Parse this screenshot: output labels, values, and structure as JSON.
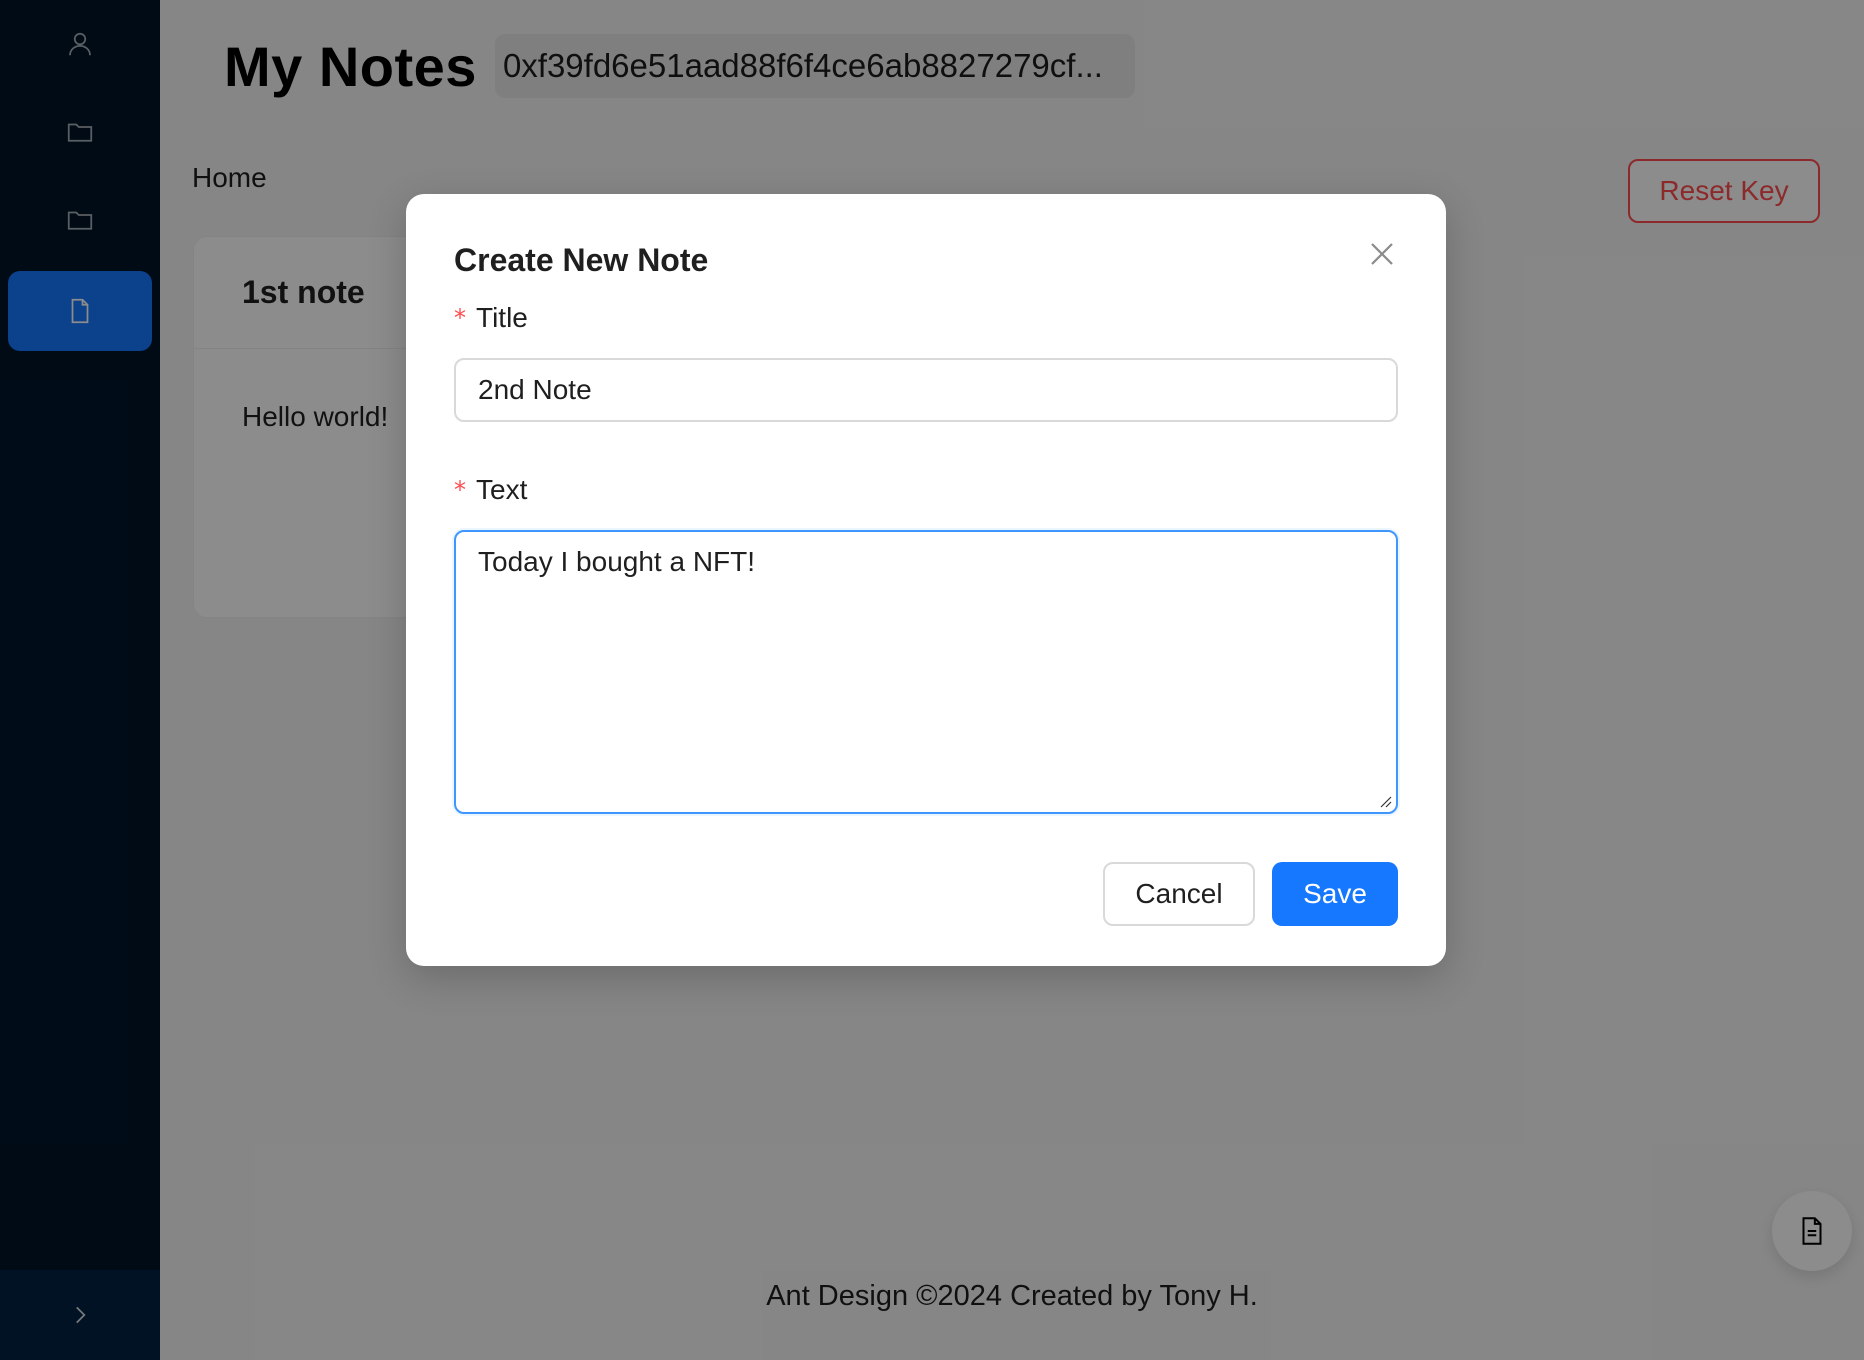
{
  "sidebar": {
    "items": [
      {
        "icon": "user-icon",
        "selected": false
      },
      {
        "icon": "folder-icon",
        "selected": false
      },
      {
        "icon": "folder-icon",
        "selected": false
      },
      {
        "icon": "file-icon",
        "selected": true
      }
    ],
    "trigger_icon": "chevron-right-icon"
  },
  "header": {
    "title": "My Notes",
    "key": "0xf39fd6e51aad88f6f4ce6ab8827279cf..."
  },
  "breadcrumb": "Home",
  "actions": {
    "reset_key_label": "Reset Key"
  },
  "note_card": {
    "title": "1st note",
    "body": "Hello world!"
  },
  "footer": "Ant Design ©2024 Created by Tony H.",
  "float_button_icon": "file-text-icon",
  "modal": {
    "title": "Create New Note",
    "title_label": "Title",
    "title_value": "2nd Note",
    "text_label": "Text",
    "text_value": "Today I bought a NFT!",
    "required_mark": "*",
    "cancel_label": "Cancel",
    "save_label": "Save"
  },
  "colors": {
    "sider_bg": "#001529",
    "primary": "#1677ff",
    "danger": "#ff4d4f"
  }
}
